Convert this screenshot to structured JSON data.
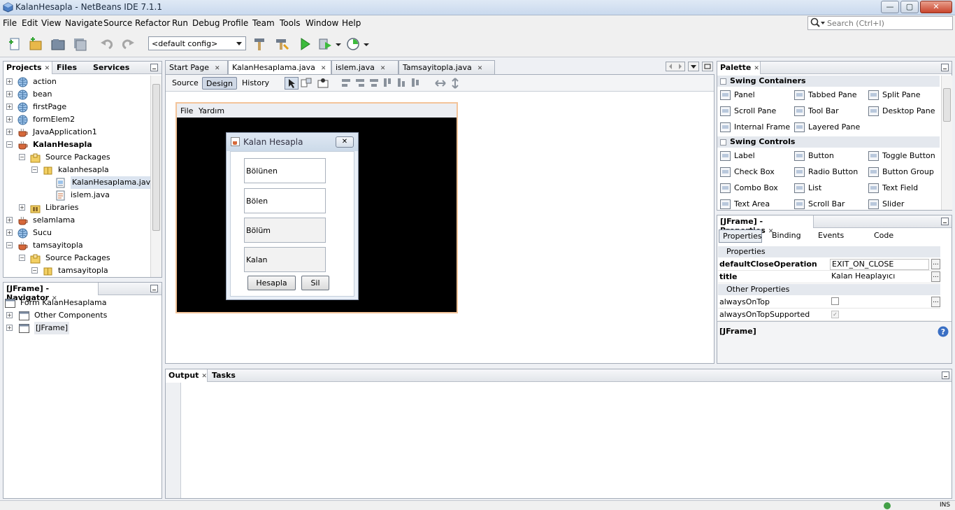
{
  "window": {
    "title": "KalanHesapla - NetBeans IDE 7.1.1",
    "min_glyph": "—",
    "max_glyph": "▢",
    "close_glyph": "✕"
  },
  "menu": [
    "File",
    "Edit",
    "View",
    "Navigate",
    "Source",
    "Refactor",
    "Run",
    "Debug",
    "Profile",
    "Team",
    "Tools",
    "Window",
    "Help"
  ],
  "search": {
    "placeholder": "Search (Ctrl+I)"
  },
  "toolbar": {
    "config_value": "<default config>"
  },
  "projects_panel": {
    "tabs": [
      "Projects",
      "Files",
      "Services"
    ],
    "tree": [
      {
        "label": "action",
        "icon": "globe-icon",
        "exp": "+",
        "indent": 0
      },
      {
        "label": "bean",
        "icon": "globe-icon",
        "exp": "+",
        "indent": 0
      },
      {
        "label": "firstPage",
        "icon": "globe-icon",
        "exp": "+",
        "indent": 0
      },
      {
        "label": "formElem2",
        "icon": "globe-icon",
        "exp": "+",
        "indent": 0
      },
      {
        "label": "JavaApplication1",
        "icon": "coffee-cup-icon",
        "exp": "+",
        "indent": 0
      },
      {
        "label": "KalanHesapla",
        "icon": "coffee-cup-icon",
        "exp": "−",
        "indent": 0,
        "bold": true
      },
      {
        "label": "Source Packages",
        "icon": "package-folder-icon",
        "exp": "−",
        "indent": 1
      },
      {
        "label": "kalanhesapla",
        "icon": "package-icon",
        "exp": "−",
        "indent": 2
      },
      {
        "label": "KalanHesaplama.java",
        "icon": "form-file-icon",
        "exp": "",
        "indent": 3,
        "selected": true
      },
      {
        "label": "islem.java",
        "icon": "java-file-icon",
        "exp": "",
        "indent": 3
      },
      {
        "label": "Libraries",
        "icon": "library-folder-icon",
        "exp": "+",
        "indent": 1
      },
      {
        "label": "selamlama",
        "icon": "coffee-cup-icon",
        "exp": "+",
        "indent": 0
      },
      {
        "label": "Sucu",
        "icon": "globe-icon",
        "exp": "+",
        "indent": 0
      },
      {
        "label": "tamsayitopla",
        "icon": "coffee-cup-icon",
        "exp": "−",
        "indent": 0
      },
      {
        "label": "Source Packages",
        "icon": "package-folder-icon",
        "exp": "−",
        "indent": 1
      },
      {
        "label": "tamsayitopla",
        "icon": "package-icon",
        "exp": "−",
        "indent": 2
      }
    ]
  },
  "navigator": {
    "title": "[JFrame] - Navigator",
    "items": [
      {
        "label": "Form KalanHesaplama",
        "indent": 0
      },
      {
        "label": "Other Components",
        "indent": 1
      },
      {
        "label": "[JFrame]",
        "indent": 1
      }
    ]
  },
  "editor": {
    "tabs": [
      "Start Page",
      "KalanHesaplama.java",
      "islem.java",
      "Tamsayitopla.java"
    ],
    "modes": [
      "Source",
      "Design",
      "History"
    ],
    "frame_menu": [
      "File",
      "Yardım"
    ],
    "dialog": {
      "title": "Kalan Hesapla",
      "fields": [
        "Bölünen",
        "Bölen",
        "Bölüm",
        "Kalan"
      ],
      "buttons": [
        "Hesapla",
        "Sil"
      ]
    }
  },
  "palette": {
    "title": "Palette",
    "sections": [
      {
        "name": "Swing Containers",
        "items": [
          "Panel",
          "Tabbed Pane",
          "Split Pane",
          "Scroll Pane",
          "Tool Bar",
          "Desktop Pane",
          "Internal Frame",
          "Layered Pane"
        ]
      },
      {
        "name": "Swing Controls",
        "items": [
          "Label",
          "Button",
          "Toggle Button",
          "Check Box",
          "Radio Button",
          "Button Group",
          "Combo Box",
          "List",
          "Text Field",
          "Text Area",
          "Scroll Bar",
          "Slider"
        ]
      }
    ]
  },
  "properties": {
    "title": "[JFrame] - Properties",
    "tabs": [
      "Properties",
      "Binding",
      "Events",
      "Code"
    ],
    "section1": "Properties",
    "rows1": [
      {
        "name": "defaultCloseOperation",
        "value": "EXIT_ON_CLOSE"
      },
      {
        "name": "title",
        "value": "Kalan Heaplayıcı"
      }
    ],
    "section2": "Other Properties",
    "rows2": [
      {
        "name": "alwaysOnTop",
        "value": ""
      },
      {
        "name": "alwaysOnTopSupported",
        "value": ""
      }
    ],
    "footer": "[JFrame]"
  },
  "output": {
    "tabs": [
      "Output",
      "Tasks"
    ]
  },
  "status": {
    "mode": "INS"
  }
}
